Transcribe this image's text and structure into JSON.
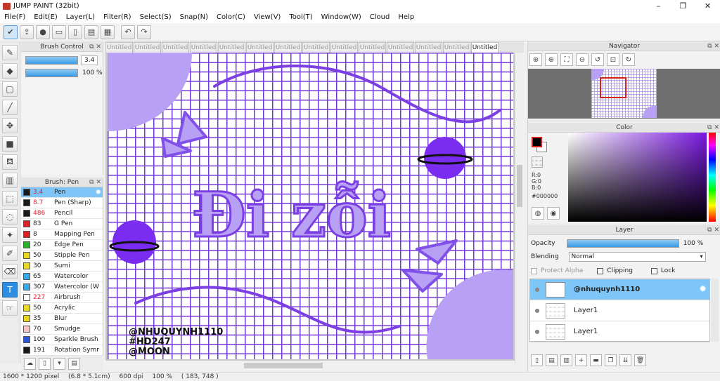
{
  "window": {
    "title": "JUMP PAINT (32bit)",
    "controls": [
      "–",
      "❐",
      "✕"
    ]
  },
  "menu": [
    "File(F)",
    "Edit(E)",
    "Layer(L)",
    "Filter(R)",
    "Select(S)",
    "Snap(N)",
    "Color(C)",
    "View(V)",
    "Tool(T)",
    "Window(W)",
    "Cloud",
    "Help"
  ],
  "toolbar": {
    "icons": [
      "cloud-sync-icon",
      "export-icon",
      "chat-bubble-icon",
      "comment-icon",
      "page-icon",
      "page-settings-icon",
      "grid-layout-icon",
      "undo-icon",
      "redo-icon"
    ]
  },
  "tools": [
    "pen-tool-icon",
    "eraser-icon",
    "rectangle-icon",
    "line-tool-icon",
    "move-icon",
    "fill-rect-icon",
    "bucket-icon",
    "gradient-icon",
    "select-rect-icon",
    "lasso-icon",
    "magic-wand-icon",
    "select-pen-icon",
    "select-eraser-icon",
    "text-icon",
    "eyedropper-hand-icon"
  ],
  "brush_control": {
    "title": "Brush Control",
    "size_value": "3.4",
    "size_fraction": 1.0,
    "opacity_value": "100 %",
    "opacity_fraction": 1.0
  },
  "brush_pen": {
    "title": "Brush: Pen",
    "items": [
      {
        "color": "#1a1a1a",
        "size": "3.4",
        "name": "Pen",
        "red": true,
        "selected": true
      },
      {
        "color": "#1a1a1a",
        "size": "8.7",
        "name": "Pen (Sharp)",
        "red": true
      },
      {
        "color": "#1a1a1a",
        "size": "486",
        "name": "Pencil",
        "red": true
      },
      {
        "color": "#e02020",
        "size": "83",
        "name": "G Pen"
      },
      {
        "color": "#e02020",
        "size": "8",
        "name": "Mapping Pen"
      },
      {
        "color": "#28b428",
        "size": "20",
        "name": "Edge Pen"
      },
      {
        "color": "#e8d820",
        "size": "50",
        "name": "Stipple Pen"
      },
      {
        "color": "#e8d820",
        "size": "30",
        "name": "Sumi"
      },
      {
        "color": "#3aa8e8",
        "size": "65",
        "name": "Watercolor"
      },
      {
        "color": "#3aa8e8",
        "size": "307",
        "name": "Watercolor (W"
      },
      {
        "color": "#ffffff",
        "size": "227",
        "name": "Airbrush",
        "red": true
      },
      {
        "color": "#e8d820",
        "size": "50",
        "name": "Acrylic"
      },
      {
        "color": "#e8d820",
        "size": "35",
        "name": "Blur"
      },
      {
        "color": "#f4c4c4",
        "size": "70",
        "name": "Smudge"
      },
      {
        "color": "#2a56d8",
        "size": "100",
        "name": "Sparkle Brush"
      },
      {
        "color": "#1a1a1a",
        "size": "191",
        "name": "Rotation Symm"
      }
    ]
  },
  "tabs": [
    "Untitled",
    "Untitled",
    "Untitled",
    "Untitled",
    "Untitled",
    "Untitled",
    "Untitled",
    "Untitled",
    "Untitled",
    "Untitled",
    "Untitled",
    "Untitled",
    "Untitled",
    "Untitled"
  ],
  "canvas": {
    "text_main": "Đi zỗi",
    "watermark": [
      "@NHUQUYNH1110",
      "#HD247",
      "@MOON"
    ],
    "colors": {
      "grid": "#6a2fd6",
      "purple_fill": "#b8a0f4",
      "planet": "#7a2cf0",
      "stroke": "#7b3fe4"
    }
  },
  "status": {
    "size_px": "1600 * 1200 pixel",
    "size_cm": "(6.8 * 5.1cm)",
    "dpi": "600 dpi",
    "zoom": "100 %",
    "cursor": "( 183, 748 )"
  },
  "navigator": {
    "title": "Navigator"
  },
  "color_panel": {
    "title": "Color",
    "r": "R:0",
    "g": "G:0",
    "b": "B:0",
    "hex": "#000000"
  },
  "layer_panel": {
    "title": "Layer",
    "opacity_label": "Opacity",
    "opacity_value": "100 %",
    "blending_label": "Blending",
    "blending_value": "Normal",
    "protect_alpha": "Protect Alpha",
    "clipping": "Clipping",
    "lock": "Lock",
    "layers": [
      {
        "name": "@nhuquynh1110",
        "selected": true
      },
      {
        "name": "Layer1"
      },
      {
        "name": "Layer1"
      }
    ]
  }
}
